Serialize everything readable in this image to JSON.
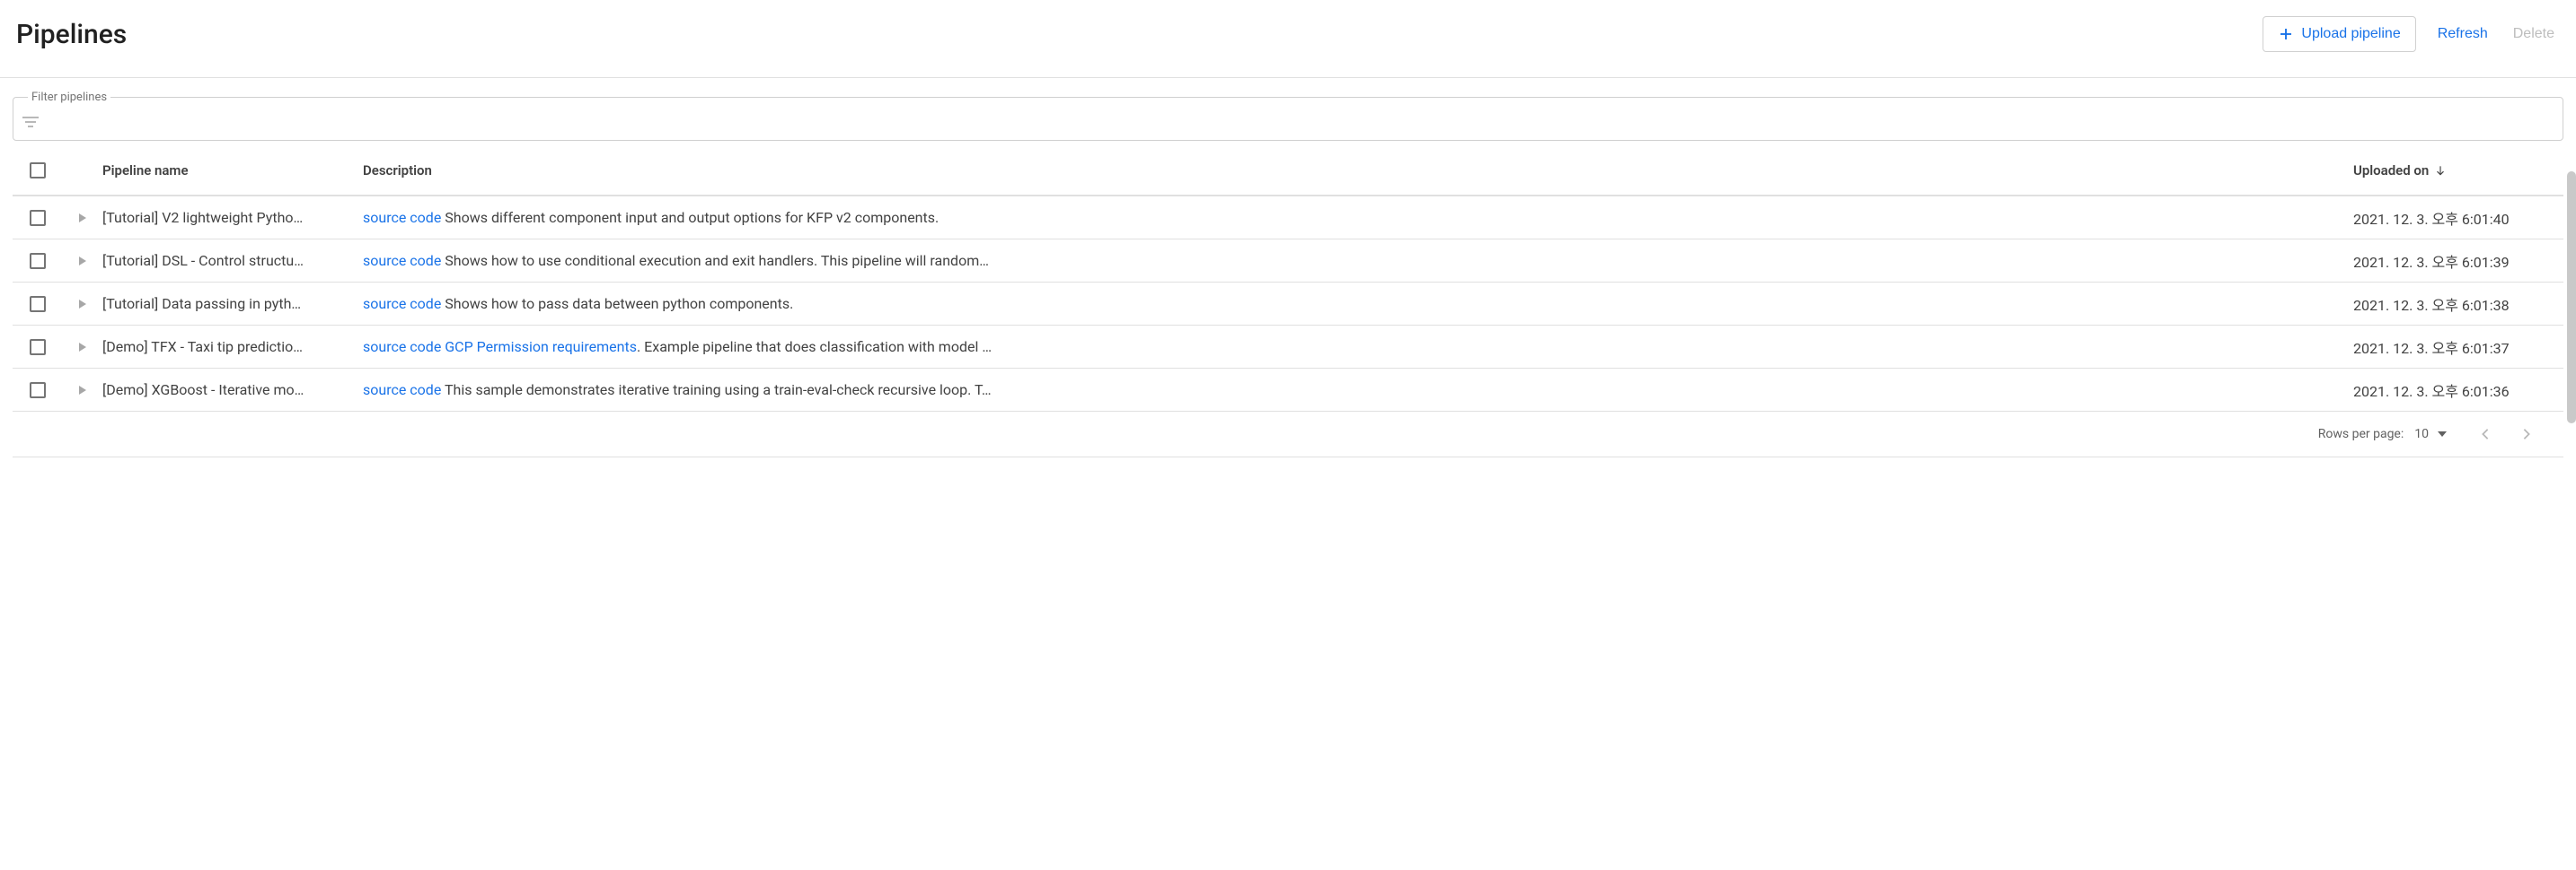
{
  "header": {
    "title": "Pipelines",
    "upload_label": "Upload pipeline",
    "refresh_label": "Refresh",
    "delete_label": "Delete"
  },
  "filter": {
    "legend": "Filter pipelines",
    "value": ""
  },
  "table": {
    "columns": {
      "name": "Pipeline name",
      "description": "Description",
      "uploaded": "Uploaded on"
    },
    "source_code_label": "source code",
    "gcp_link_label": "GCP Permission requirements",
    "rows": [
      {
        "name": "[Tutorial] V2 lightweight Pytho…",
        "desc_after": " Shows different component input and output options for KFP v2 components.",
        "uploaded": "2021. 12. 3. 오후 6:01:40",
        "has_gcp_link": false
      },
      {
        "name": "[Tutorial] DSL - Control structu…",
        "desc_after": " Shows how to use conditional execution and exit handlers. This pipeline will random…",
        "uploaded": "2021. 12. 3. 오후 6:01:39",
        "has_gcp_link": false
      },
      {
        "name": "[Tutorial] Data passing in pyth…",
        "desc_after": " Shows how to pass data between python components.",
        "uploaded": "2021. 12. 3. 오후 6:01:38",
        "has_gcp_link": false
      },
      {
        "name": "[Demo] TFX - Taxi tip predictio…",
        "desc_after": ". Example pipeline that does classification with model …",
        "uploaded": "2021. 12. 3. 오후 6:01:37",
        "has_gcp_link": true
      },
      {
        "name": "[Demo] XGBoost - Iterative mo…",
        "desc_after": " This sample demonstrates iterative training using a train-eval-check recursive loop. T…",
        "uploaded": "2021. 12. 3. 오후 6:01:36",
        "has_gcp_link": false
      }
    ]
  },
  "pagination": {
    "rows_per_page_label": "Rows per page:",
    "rows_per_page_value": "10"
  }
}
